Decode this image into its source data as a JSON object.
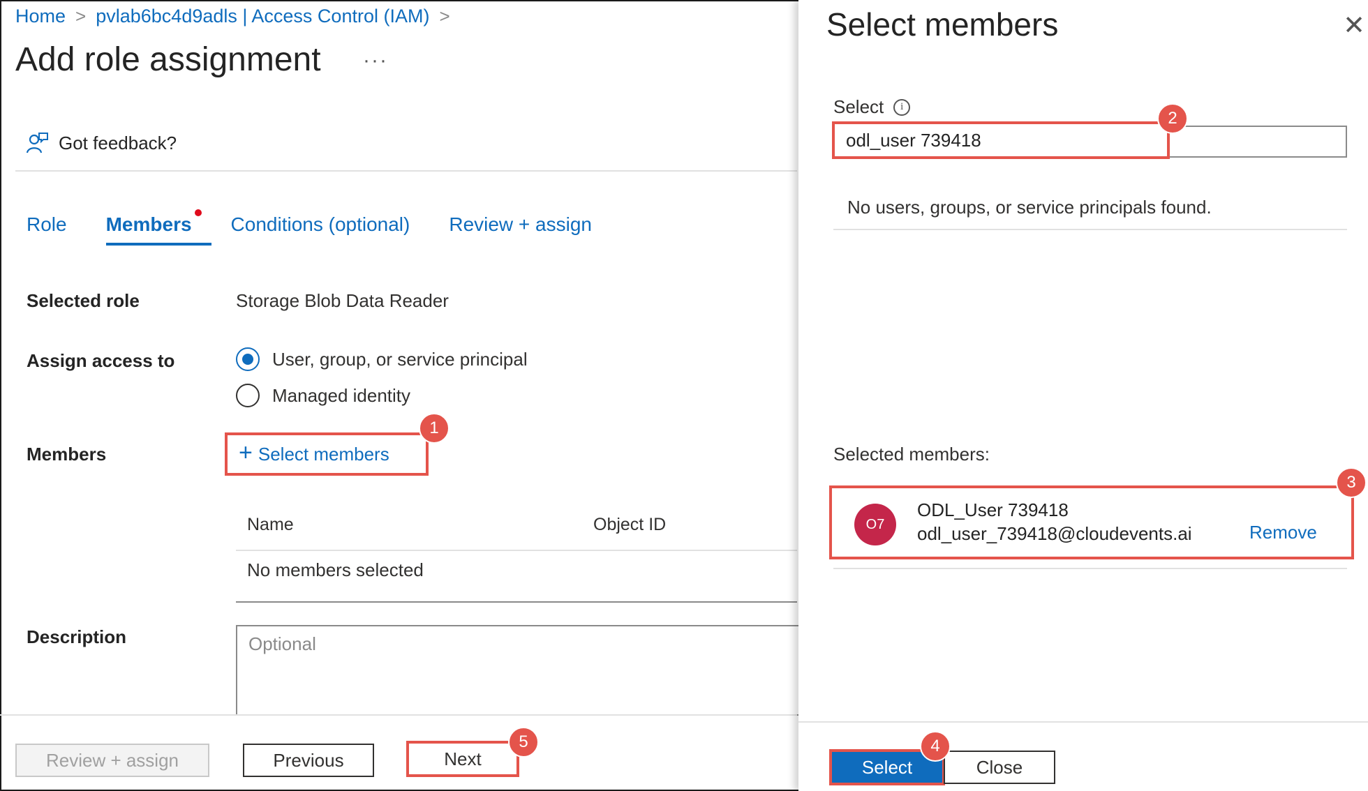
{
  "breadcrumb": {
    "home": "Home",
    "resource": "pvlab6bc4d9adls | Access Control (IAM)"
  },
  "page": {
    "title": "Add role assignment",
    "more": "···"
  },
  "feedback": {
    "label": "Got feedback?",
    "icon": "feedback-person-icon"
  },
  "tabs": [
    {
      "label": "Role"
    },
    {
      "label": "Members",
      "active": true
    },
    {
      "label": "Conditions (optional)"
    },
    {
      "label": "Review + assign"
    }
  ],
  "form": {
    "selected_role_label": "Selected role",
    "selected_role_value": "Storage Blob Data Reader",
    "assign_access_label": "Assign access to",
    "assign_options": [
      {
        "label": "User, group, or service principal",
        "checked": true
      },
      {
        "label": "Managed identity",
        "checked": false
      }
    ],
    "members_label": "Members",
    "select_members_link": "Select members",
    "table": {
      "col_name": "Name",
      "col_object_id": "Object ID",
      "empty": "No members selected"
    },
    "description_label": "Description",
    "description_placeholder": "Optional"
  },
  "footer": {
    "review_assign": "Review + assign",
    "previous": "Previous",
    "next": "Next"
  },
  "panel": {
    "title": "Select members",
    "select_label": "Select",
    "search_value": "odl_user 739418",
    "no_results": "No users, groups, or service principals found.",
    "selected_members_label": "Selected members:",
    "member": {
      "initials": "O7",
      "name": "ODL_User 739418",
      "email": "odl_user_739418@cloudevents.ai",
      "remove": "Remove"
    },
    "select_button": "Select",
    "close_button": "Close"
  },
  "callouts": [
    "1",
    "2",
    "3",
    "4",
    "5"
  ],
  "colors": {
    "accent": "#0f6cbd",
    "callout": "#e4544b",
    "avatar": "#c4264a"
  }
}
